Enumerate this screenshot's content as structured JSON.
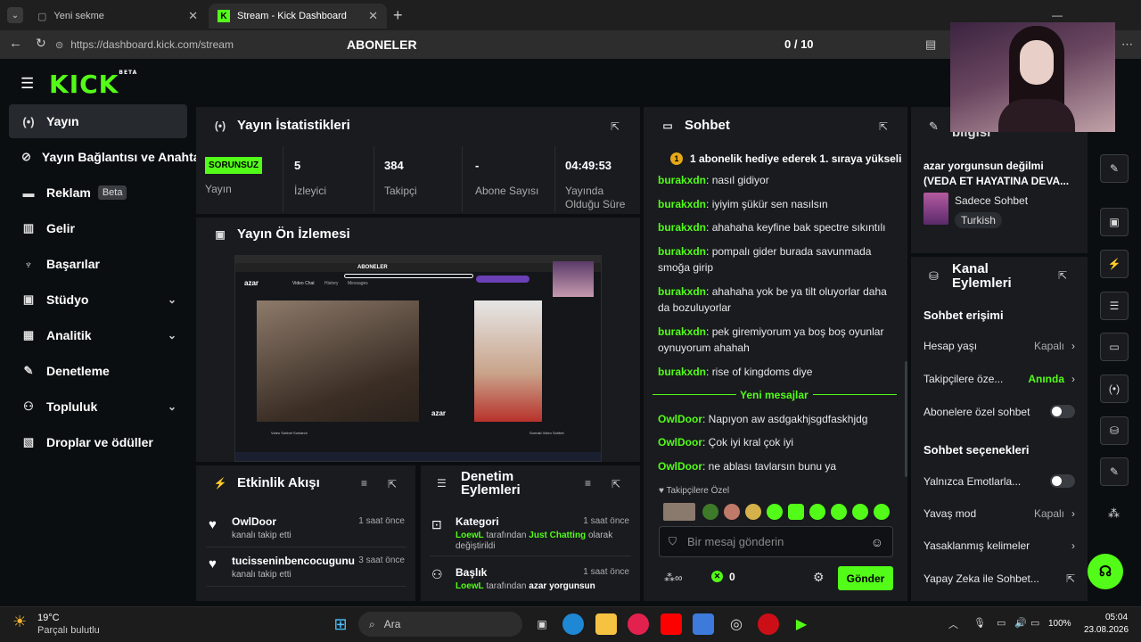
{
  "browser": {
    "tabs": [
      {
        "title": "Yeni sekme"
      },
      {
        "title": "Stream - Kick Dashboard"
      }
    ],
    "url": "https://dashboard.kick.com/stream"
  },
  "overlay": {
    "title": "ABONELER",
    "count": "0 / 10",
    "progress": 0
  },
  "logo": {
    "text": "KICK",
    "beta": "BETA"
  },
  "sidebar": {
    "items": [
      {
        "label": "Yayın",
        "icon": "broadcast-icon"
      },
      {
        "label": "Yayın Bağlantısı ve Anahtarı",
        "icon": "link-icon"
      },
      {
        "label": "Reklam",
        "badge": "Beta",
        "icon": "ad-icon"
      },
      {
        "label": "Gelir",
        "icon": "revenue-icon"
      },
      {
        "label": "Başarılar",
        "icon": "trophy-icon"
      },
      {
        "label": "Stüdyo",
        "icon": "studio-icon"
      },
      {
        "label": "Analitik",
        "icon": "chart-icon"
      },
      {
        "label": "Denetleme",
        "icon": "wrench-icon"
      },
      {
        "label": "Topluluk",
        "icon": "community-icon"
      },
      {
        "label": "Droplar ve ödüller",
        "icon": "gift-icon"
      }
    ]
  },
  "stats": {
    "title": "Yayın İstatistikleri",
    "status": "SORUNSUZ",
    "status_label": "Yayın",
    "items": [
      {
        "value": "5",
        "label": "İzleyici"
      },
      {
        "value": "384",
        "label": "Takipçi"
      },
      {
        "value": "-",
        "label": "Abone Sayısı"
      },
      {
        "value": "04:49:53",
        "label": "Yayında Olduğu Süre"
      }
    ]
  },
  "preview": {
    "title": "Yayın Ön İzlemesi",
    "inner_title": "ABONELER",
    "inner_logo": "azar",
    "inner_tabs": [
      "Video Chat",
      "History",
      "Messages"
    ],
    "inner_left_label": "Video Sohbet Sonlandı",
    "inner_right_label": "Sonraki Video Sohbet"
  },
  "activity": {
    "title": "Etkinlik Akışı",
    "items": [
      {
        "user": "OwlDoor",
        "action": "kanalı takip etti",
        "time": "1 saat önce"
      },
      {
        "user": "tucisseninbencocugunu",
        "action": "kanalı takip etti",
        "time": "3 saat önce"
      }
    ]
  },
  "moderation": {
    "title": "Denetim Eylemleri",
    "items": [
      {
        "heading": "Kategori",
        "time": "1 saat önce",
        "actor": "LoewL",
        "mid": "tarafından",
        "target": "Just Chatting",
        "tail": "olarak değiştirildi"
      },
      {
        "heading": "Başlık",
        "time": "1 saat önce",
        "actor": "LoewL",
        "mid": "tarafından",
        "target": "azar yorgunsun",
        "tail": ""
      }
    ]
  },
  "chat": {
    "title": "Sohbet",
    "pinned": "1 abonelik hediye ederek 1. sıraya yükseli",
    "messages": [
      {
        "user": "burakxdn",
        "text": "nasıl gidiyor"
      },
      {
        "user": "burakxdn",
        "text": "iyiyim şükür sen nasılsın"
      },
      {
        "user": "burakxdn",
        "text": "ahahaha keyfine bak spectre sıkıntılı"
      },
      {
        "user": "burakxdn",
        "text": "pompalı gider burada savunmada smoğa girip"
      },
      {
        "user": "burakxdn",
        "text": "ahahaha yok be ya tilt oluyorlar daha da bozuluyorlar"
      },
      {
        "user": "burakxdn",
        "text": "pek giremiyorum ya boş boş oyunlar oynuyorum ahahah"
      },
      {
        "user": "burakxdn",
        "text": "rise of kingdoms diye"
      }
    ],
    "new_divider": "Yeni mesajlar",
    "new_messages": [
      {
        "user": "OwlDoor",
        "text": "Napıyon aw asdgakhjsgdfaskhjdg"
      },
      {
        "user": "OwlDoor",
        "text": "Çok iyi kral çok iyi"
      },
      {
        "user": "OwlDoor",
        "text": "ne ablası tavlarsın bunu ya"
      }
    ],
    "emote_label": "Takipçilere Özel",
    "input_placeholder": "Bir mesaj gönderin",
    "points": "0",
    "send": "Gönder"
  },
  "stream_info": {
    "title_partial": "bilgisi",
    "stream_title": "azar yorgunsun değilmi (VEDA ET HAYATINA DEVA...",
    "category": "Sadece Sohbet",
    "language": "Turkish"
  },
  "channel_actions": {
    "title": "Kanal Eylemleri",
    "access_heading": "Sohbet erişimi",
    "rows1": [
      {
        "label": "Hesap yaşı",
        "value": "Kapalı"
      },
      {
        "label": "Takipçilere öze...",
        "value": "Anında"
      },
      {
        "label": "Abonelere özel sohbet",
        "value": ""
      }
    ],
    "options_heading": "Sohbet seçenekleri",
    "rows2": [
      {
        "label": "Yalnızca Emotlarla...",
        "value": ""
      },
      {
        "label": "Yavaş mod",
        "value": "Kapalı"
      },
      {
        "label": "Yasaklanmış kelimeler",
        "value": ""
      },
      {
        "label": "Yapay Zeka ile Sohbet...",
        "value": ""
      }
    ]
  },
  "taskbar": {
    "weather_temp": "19°C",
    "weather_desc": "Parçalı bulutlu",
    "search": "Ara",
    "battery": "100%",
    "time": "05:04",
    "date": "23.08.2026"
  }
}
